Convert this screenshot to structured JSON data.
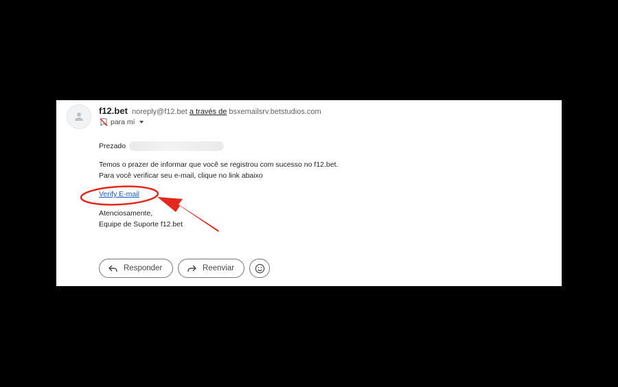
{
  "email": {
    "sender_name": "f12.bet",
    "sender_address": "noreply@f12.bet",
    "via_label": "a través de",
    "via_domain": "bsxemailsrv.betstudios.com",
    "recipient_label": "para mí"
  },
  "body": {
    "greeting": "Prezado",
    "line1": "Temos o prazer de informar que você se registrou com sucesso no f12.bet.",
    "line2": "Para você verificar seu e-mail, clique no link abaixo",
    "link_label": "Verify E-mail",
    "closing1": "Atenciosamente,",
    "closing2": "Equipe de Suporte f12.bet"
  },
  "actions": {
    "reply_label": "Responder",
    "forward_label": "Reenviar"
  },
  "annotation": {
    "color": "#e5281f"
  },
  "icons": {
    "avatar": "person-icon",
    "recipient": "important-marker-icon",
    "dropdown": "caret-down-icon",
    "reply": "reply-arrow-icon",
    "forward": "forward-arrow-icon",
    "emoji": "smiley-icon"
  }
}
